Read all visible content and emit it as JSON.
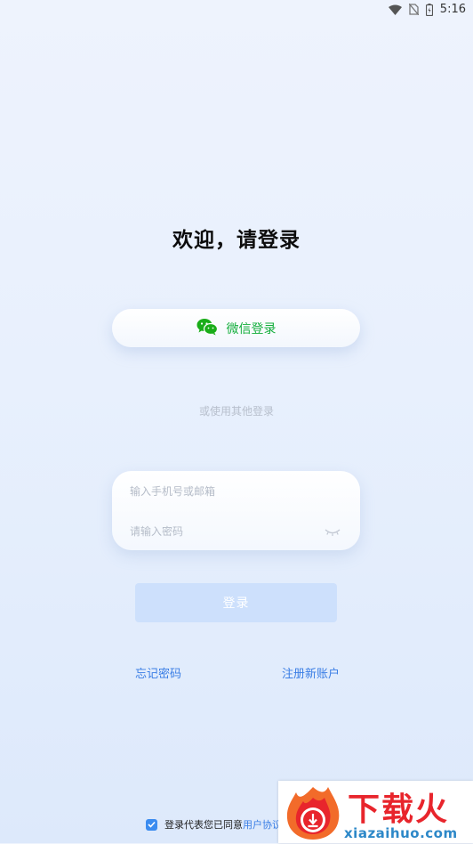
{
  "status_bar": {
    "time": "5:16",
    "icons": [
      "wifi-icon",
      "no-sim-icon",
      "battery-icon"
    ]
  },
  "welcome": {
    "title": "欢迎，请登录"
  },
  "wechat_login": {
    "label": "微信登录",
    "icon": "wechat-icon",
    "color": "#14ae3c"
  },
  "alt_login": {
    "text": "或使用其他登录"
  },
  "form": {
    "phone_placeholder": "输入手机号或邮箱",
    "password_placeholder": "请输入密码",
    "eye_icon": "eye-closed-icon"
  },
  "login_button": {
    "label": "登录",
    "bg": "#cde0fc"
  },
  "links": {
    "forgot": "忘记密码",
    "register": "注册新账户"
  },
  "agreement": {
    "prefix": "登录代表您已同意",
    "link": "用户协议",
    "checked": true
  },
  "watermark": {
    "title": "下载火",
    "site": "xiazaihuo.com"
  },
  "colors": {
    "accent": "#3a7ee5",
    "checkbox": "#3b8cf0"
  }
}
